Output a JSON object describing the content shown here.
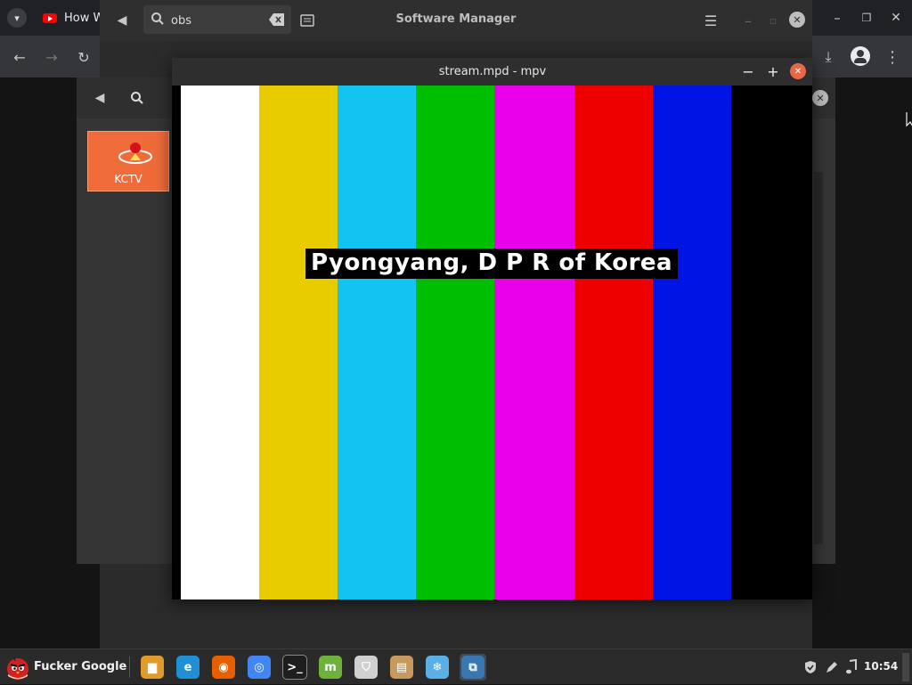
{
  "browser": {
    "tab_title": "How W",
    "tab_color": "#ff0000"
  },
  "software_manager": {
    "title": "Software Manager",
    "search_value": "obs"
  },
  "iptv": {
    "channel_label": "KCTV",
    "card_color": "#f06b3a"
  },
  "mpv": {
    "title": "stream.mpd - mpv",
    "caption": "Pyongyang, D P R of Korea",
    "color_bars": [
      "#ffffff",
      "#e8cc00",
      "#12c4f2",
      "#00be00",
      "#e800e8",
      "#ee0000",
      "#0014e6",
      "#000000"
    ]
  },
  "taskbar": {
    "menu_label": "Fucker Google",
    "apps": [
      {
        "name": "files-icon",
        "color": "#e09b2d"
      },
      {
        "name": "edge-dev-icon",
        "color": "#1f8fd6"
      },
      {
        "name": "firefox-icon",
        "color": "#e66000"
      },
      {
        "name": "chrome-icon",
        "color": "#4285f4"
      },
      {
        "name": "terminal-icon",
        "color": "#1e1e1e"
      },
      {
        "name": "mintinstall-icon",
        "color": "#6fb23b"
      },
      {
        "name": "shield-icon",
        "color": "#d0d0d0"
      },
      {
        "name": "archive-icon",
        "color": "#c79a5c"
      },
      {
        "name": "snowflake-icon",
        "color": "#5ab0e6"
      },
      {
        "name": "python-icon",
        "color": "#3a77b0"
      }
    ],
    "clock": "10:54"
  }
}
